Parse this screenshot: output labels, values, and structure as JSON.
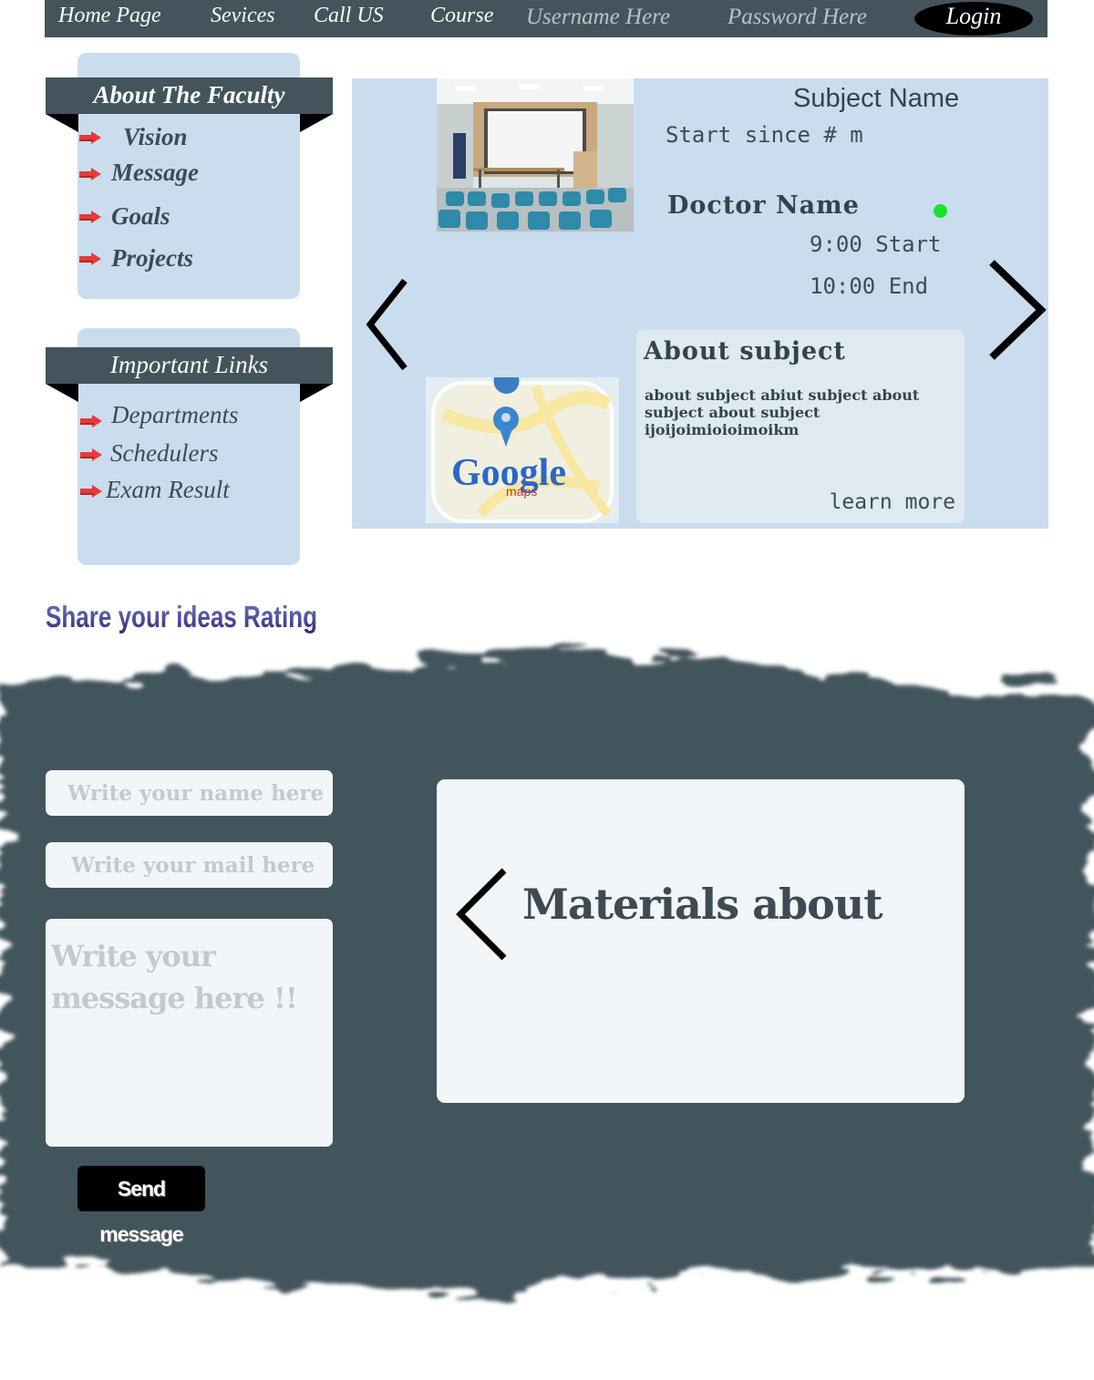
{
  "nav": {
    "items": [
      "Home Page",
      "Sevices",
      "Call US",
      "Course"
    ],
    "username_placeholder": "Username Here",
    "password_placeholder": "Password Here",
    "login_label": "Login"
  },
  "faculty_panel": {
    "title": "About The Faculty",
    "links": [
      "Vision",
      "Message",
      "Goals",
      "Projects"
    ]
  },
  "links_panel": {
    "title": "Important Links",
    "links": [
      "Departments",
      "Schedulers",
      "Exam Result"
    ]
  },
  "course": {
    "subject_name": "Subject Name",
    "start_since": "Start since # m",
    "doctor_name": "Doctor Name",
    "start_time": "9:00 Start",
    "end_time": "10:00 End",
    "about_title": "About subject",
    "about_text": "about subject abiut subject about subject about subject ijoijoimioioimoikm",
    "learn_more": "learn more",
    "maps_logo_text": "Google",
    "maps_logo_sub": "maps"
  },
  "share_banner_text": "Share your ideas Rating",
  "contact_form": {
    "name_placeholder": "Write your name here",
    "mail_placeholder": "Write your mail here",
    "message_placeholder": "Write your message here !!",
    "send_label": "Send message"
  },
  "materials": {
    "title": "Materials about"
  },
  "colors": {
    "nav_bg": "#43545d",
    "panel_bg": "#c9ddef",
    "status_online": "#18e32a"
  }
}
